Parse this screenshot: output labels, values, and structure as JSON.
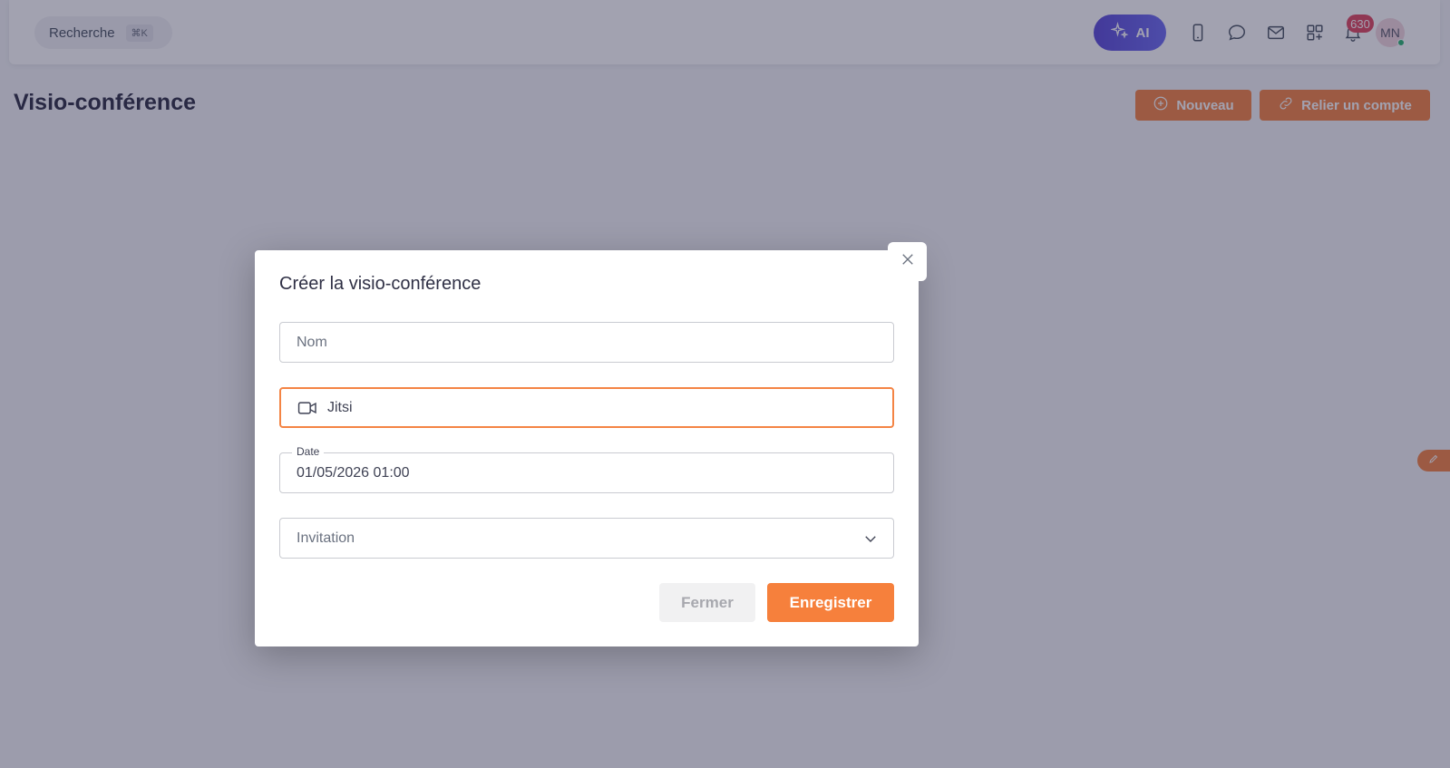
{
  "topbar": {
    "search_label": "Recherche",
    "search_shortcut": "⌘K",
    "ai_label": "AI",
    "notification_count": "630",
    "avatar_initials": "MN",
    "icons": [
      "sparkle-icon",
      "phone-icon",
      "chat-icon",
      "mail-icon",
      "apps-icon",
      "bell-icon"
    ]
  },
  "page": {
    "title": "Visio-conférence",
    "new_button": "Nouveau",
    "link_account_button": "Relier un compte"
  },
  "modal": {
    "title": "Créer la visio-conférence",
    "name_placeholder": "Nom",
    "provider_value": "Jitsi",
    "date_label": "Date",
    "date_value": "01/05/2026 01:00",
    "invitation_placeholder": "Invitation",
    "close_button": "Fermer",
    "save_button": "Enregistrer"
  },
  "colors": {
    "accent": "#f48444",
    "ai_gradient_start": "#5b4bd8",
    "ai_gradient_end": "#6d6cf2",
    "badge": "#e0485f"
  }
}
